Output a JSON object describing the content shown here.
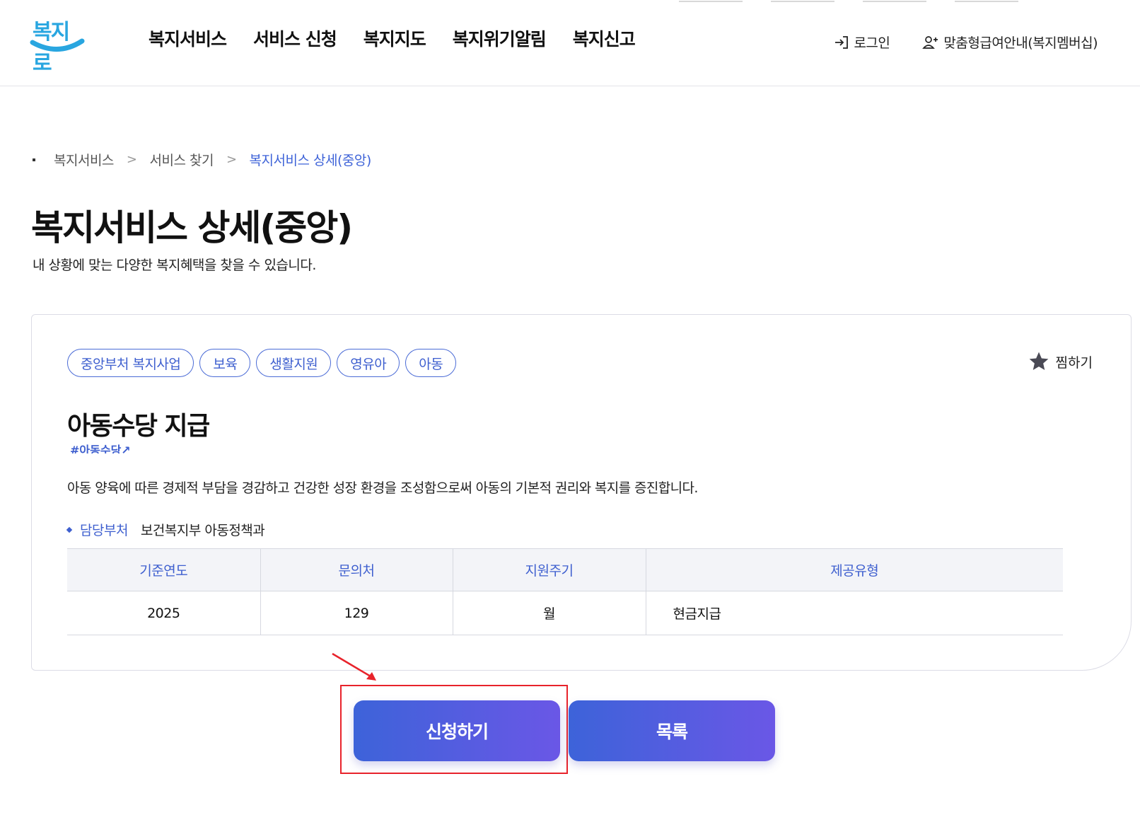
{
  "header": {
    "logo_text": "복지로",
    "gnb": [
      "복지서비스",
      "서비스 신청",
      "복지지도",
      "복지위기알림",
      "복지신고"
    ],
    "login_label": "로그인",
    "membership_label": "맞춤형급여안내(복지멤버십)"
  },
  "breadcrumb": [
    "복지서비스",
    "서비스 찾기",
    "복지서비스 상세(중앙)"
  ],
  "page": {
    "title": "복지서비스 상세(중앙)",
    "description": "내 상황에 맞는 다양한 복지혜택을 찾을 수 있습니다."
  },
  "service": {
    "tags": [
      "중앙부처 복지사업",
      "보육",
      "생활지원",
      "영유아",
      "아동"
    ],
    "favorite_label": "찜하기",
    "title": "아동수당 지급",
    "hashtag": "#아동수당",
    "description": "아동 양육에 따른 경제적 부담을 경감하고 건강한 성장 환경을 조성함으로써 아동의 기본적 권리와 복지를 증진합니다.",
    "dept_label": "담당부처",
    "dept_value": "보건복지부 아동정책과",
    "table": {
      "headers": [
        "기준연도",
        "문의처",
        "지원주기",
        "제공유형"
      ],
      "row": [
        "2025",
        "129",
        "월",
        "현금지급"
      ]
    }
  },
  "buttons": {
    "apply": "신청하기",
    "list": "목록"
  },
  "colors": {
    "accent": "#3e5fcf",
    "button_gradient_start": "#3d63d9",
    "button_gradient_end": "#6a57e6",
    "highlight": "#e8232b"
  }
}
